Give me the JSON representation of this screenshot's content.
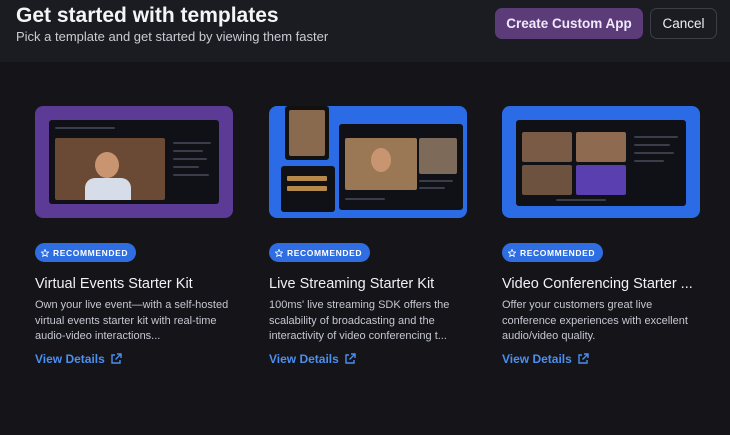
{
  "header": {
    "title": "Get started with templates",
    "subtitle": "Pick a template and get started by viewing them faster",
    "primary_button": "Create Custom App",
    "cancel_button": "Cancel"
  },
  "cards": [
    {
      "badge": "RECOMMENDED",
      "title": "Virtual Events Starter Kit",
      "description": "Own your live event—with a self-hosted virtual events starter kit with real-time audio-video interactions...",
      "link": "View Details"
    },
    {
      "badge": "RECOMMENDED",
      "title": "Live Streaming Starter Kit",
      "description": "100ms' live streaming SDK offers the scalability of broadcasting and the interactivity of video conferencing t...",
      "link": "View Details"
    },
    {
      "badge": "RECOMMENDED",
      "title": "Video Conferencing Starter ...",
      "description": "Offer your customers great live conference experiences with excellent audio/video quality.",
      "link": "View Details"
    }
  ],
  "colors": {
    "background": "#141419",
    "header_bg": "#1b1c22",
    "primary_button": "#5b3c78",
    "badge": "#2f6de2",
    "link": "#4b8ff0",
    "thumb_purple": "#5b3b96",
    "thumb_blue": "#2b6be6"
  },
  "icons": {
    "badge": "star-icon",
    "link": "external-link-icon"
  }
}
